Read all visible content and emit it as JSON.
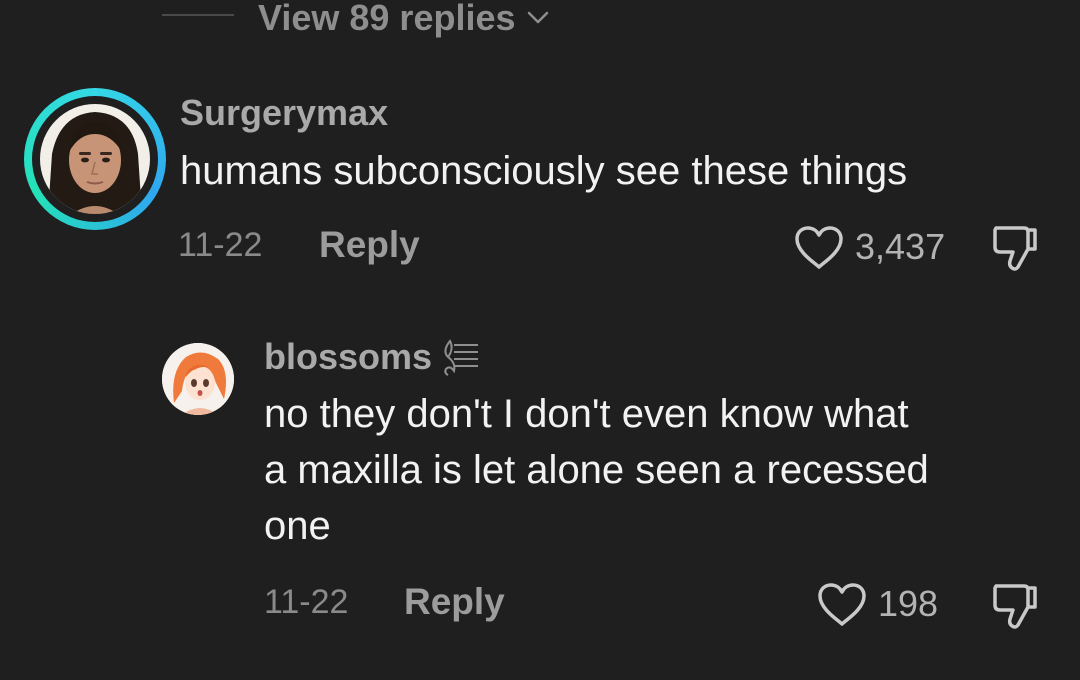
{
  "thread": {
    "view_replies_label": "View 89 replies"
  },
  "comments": [
    {
      "username": "Surgerymax",
      "text": "humans subconsciously see these things",
      "date": "11-22",
      "reply_label": "Reply",
      "likes": "3,437"
    },
    {
      "username": "blossoms",
      "text_lines": [
        "no they don't I don't even know what",
        "a maxilla is let alone seen a recessed",
        "one"
      ],
      "date": "11-22",
      "reply_label": "Reply",
      "likes": "198"
    }
  ],
  "icons": {
    "chevron": "chevron-down-icon",
    "like": "heart-outline-icon",
    "dislike": "thumbs-down-icon",
    "badge": "music-notes-icon"
  },
  "colors": {
    "background": "#1f1f1f",
    "ring_start": "#34d8e6",
    "ring_end": "#24e2b8"
  }
}
